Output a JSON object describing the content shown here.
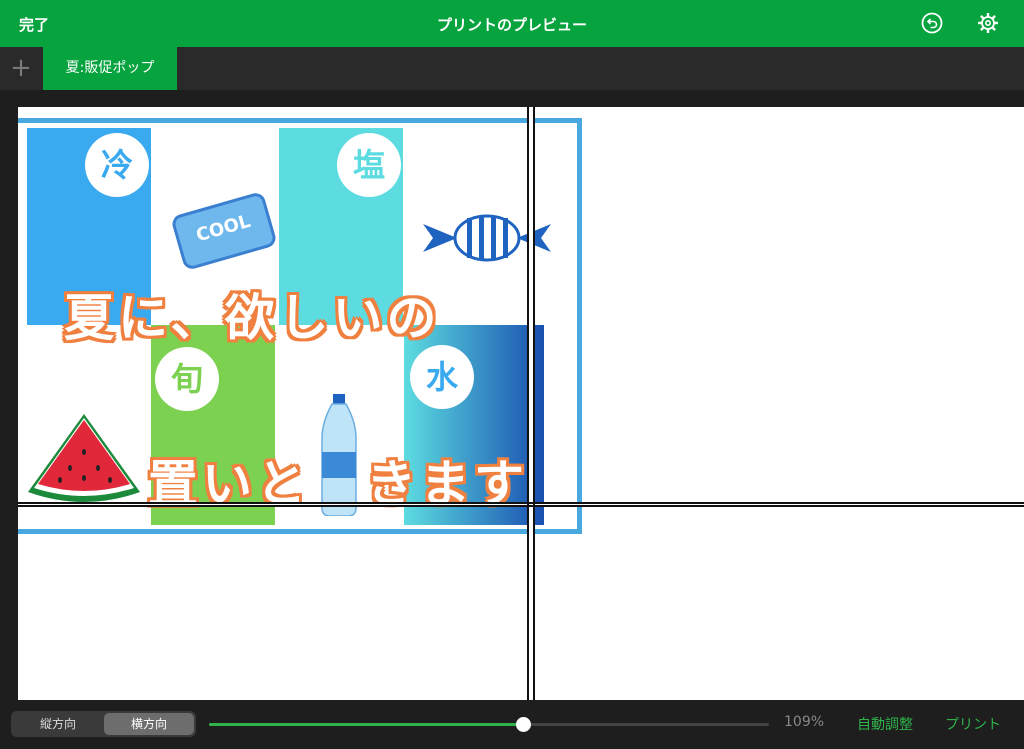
{
  "topbar": {
    "done_label": "完了",
    "title": "プリントのプレビュー",
    "undo_icon": "undo-icon",
    "settings_icon": "gear-icon"
  },
  "tabs": {
    "add_icon": "plus-icon",
    "items": [
      {
        "label": "夏:販促ポップ"
      }
    ]
  },
  "poster": {
    "labels": {
      "cold": "冷",
      "salt": "塩",
      "season": "旬",
      "water": "水",
      "candy_text": "COOL"
    },
    "headline_1": "夏に、欲しいの",
    "headline_2": "置いと",
    "headline_3": "きます",
    "colors": {
      "blue": "#39a9f0",
      "cyan": "#5cdce0",
      "green": "#7dd150",
      "orange_outline": "#f08040",
      "frame": "#4aa8e0"
    }
  },
  "bottombar": {
    "orientation": {
      "portrait": "縦方向",
      "landscape": "横方向",
      "selected": "landscape"
    },
    "zoom_slider_fraction": 0.56,
    "zoom_label": "109%",
    "auto_fit_label": "自動調整",
    "print_label": "プリント"
  },
  "colors": {
    "accent": "#07a33f",
    "slider": "#2fb24a"
  }
}
